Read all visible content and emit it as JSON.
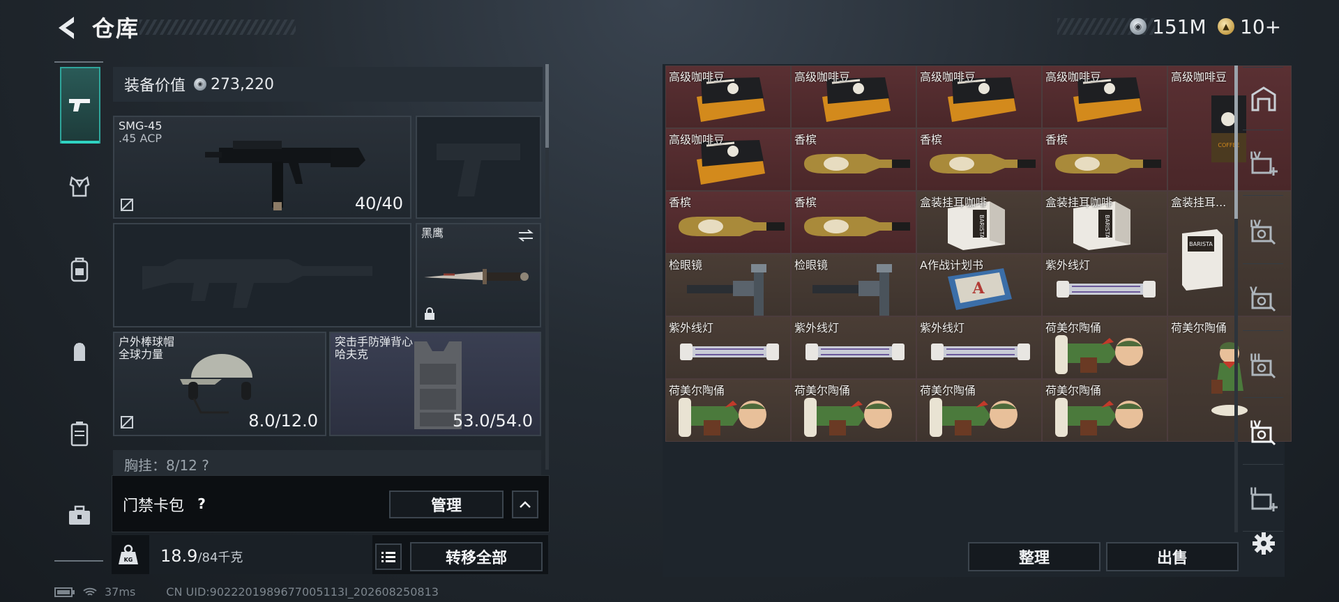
{
  "header": {
    "title": "仓库",
    "currencies": [
      {
        "icon": "silver-coin-icon",
        "value": "151M"
      },
      {
        "icon": "gold-coin-icon",
        "value": "10+"
      }
    ]
  },
  "leftnav": {
    "items": [
      {
        "icon": "pistol-icon",
        "active": true
      },
      {
        "icon": "vest-icon",
        "active": false
      },
      {
        "icon": "backpack-rig-icon",
        "active": false
      },
      {
        "icon": "backpack-icon",
        "active": false
      },
      {
        "icon": "case-icon",
        "active": false
      },
      {
        "icon": "toolbox-icon",
        "active": false
      }
    ]
  },
  "equipment": {
    "value_label": "装备价值",
    "value": "273,220",
    "primary": {
      "name": "SMG-45",
      "ammo": ".45 ACP",
      "count": "40/40"
    },
    "melee": {
      "name": "黑鹰"
    },
    "helmet": {
      "name": "户外棒球帽",
      "sub": "全球力量",
      "count": "8.0/12.0"
    },
    "armor": {
      "name": "突击手防弹背心",
      "sub": "哈夫克",
      "count": "53.0/54.0"
    },
    "chest_rig": "胸挂：8/12  ?"
  },
  "cardpack": {
    "label": "门禁卡包",
    "help": "?",
    "manage_label": "管理"
  },
  "weight": {
    "current": "18.9",
    "max": "/84千克",
    "transfer_all_label": "转移全部"
  },
  "status_bar": {
    "ping": "37ms",
    "uid": "CN UID:9022201989677005113I_202608250813"
  },
  "stash": {
    "items": [
      {
        "name": "高级咖啡豆",
        "kind": "coffee"
      },
      {
        "name": "高级咖啡豆",
        "kind": "coffee"
      },
      {
        "name": "高级咖啡豆",
        "kind": "coffee"
      },
      {
        "name": "高级咖啡豆",
        "kind": "coffee"
      },
      {
        "name": "高级咖啡豆",
        "kind": "coffee-tall"
      },
      {
        "name": "高级咖啡豆",
        "kind": "coffee"
      },
      {
        "name": "香槟",
        "kind": "champagne"
      },
      {
        "name": "香槟",
        "kind": "champagne"
      },
      {
        "name": "香槟",
        "kind": "champagne"
      },
      {
        "name": "香槟",
        "kind": "champagne"
      },
      {
        "name": "香槟",
        "kind": "champagne"
      },
      {
        "name": "盒装挂耳咖啡",
        "kind": "dripbox"
      },
      {
        "name": "盒装挂耳咖啡",
        "kind": "dripbox"
      },
      {
        "name": "盒装挂耳...",
        "kind": "dripbox-tall"
      },
      {
        "name": "检眼镜",
        "kind": "scope"
      },
      {
        "name": "检眼镜",
        "kind": "scope"
      },
      {
        "name": "A作战计划书",
        "kind": "plan"
      },
      {
        "name": "紫外线灯",
        "kind": "uvlamp"
      },
      {
        "name": "紫外线灯",
        "kind": "uvlamp"
      },
      {
        "name": "紫外线灯",
        "kind": "uvlamp"
      },
      {
        "name": "紫外线灯",
        "kind": "uvlamp"
      },
      {
        "name": "荷美尔陶俑",
        "kind": "figurine"
      },
      {
        "name": "荷美尔陶俑",
        "kind": "figurine-tall"
      },
      {
        "name": "荷美尔陶俑",
        "kind": "figurine"
      },
      {
        "name": "荷美尔陶俑",
        "kind": "figurine"
      },
      {
        "name": "荷美尔陶俑",
        "kind": "figurine"
      },
      {
        "name": "荷美尔陶俑",
        "kind": "figurine"
      }
    ],
    "sort_label": "整理",
    "sell_label": "出售"
  },
  "rightnav": {
    "items": [
      {
        "icon": "stash-gate-icon",
        "roman": ""
      },
      {
        "icon": "add-box-icon",
        "roman": "IV"
      },
      {
        "icon": "box-icon",
        "roman": "IV"
      },
      {
        "icon": "box-icon",
        "roman": "V"
      },
      {
        "icon": "box-icon",
        "roman": "III"
      },
      {
        "icon": "box-icon",
        "roman": "IV"
      },
      {
        "icon": "add-box-icon",
        "roman": "II"
      }
    ],
    "settings_icon": "gear-icon"
  },
  "colors": {
    "accent": "#2fd3c2",
    "red_cell": "#5a3033",
    "brown_cell": "#4a3d35"
  }
}
